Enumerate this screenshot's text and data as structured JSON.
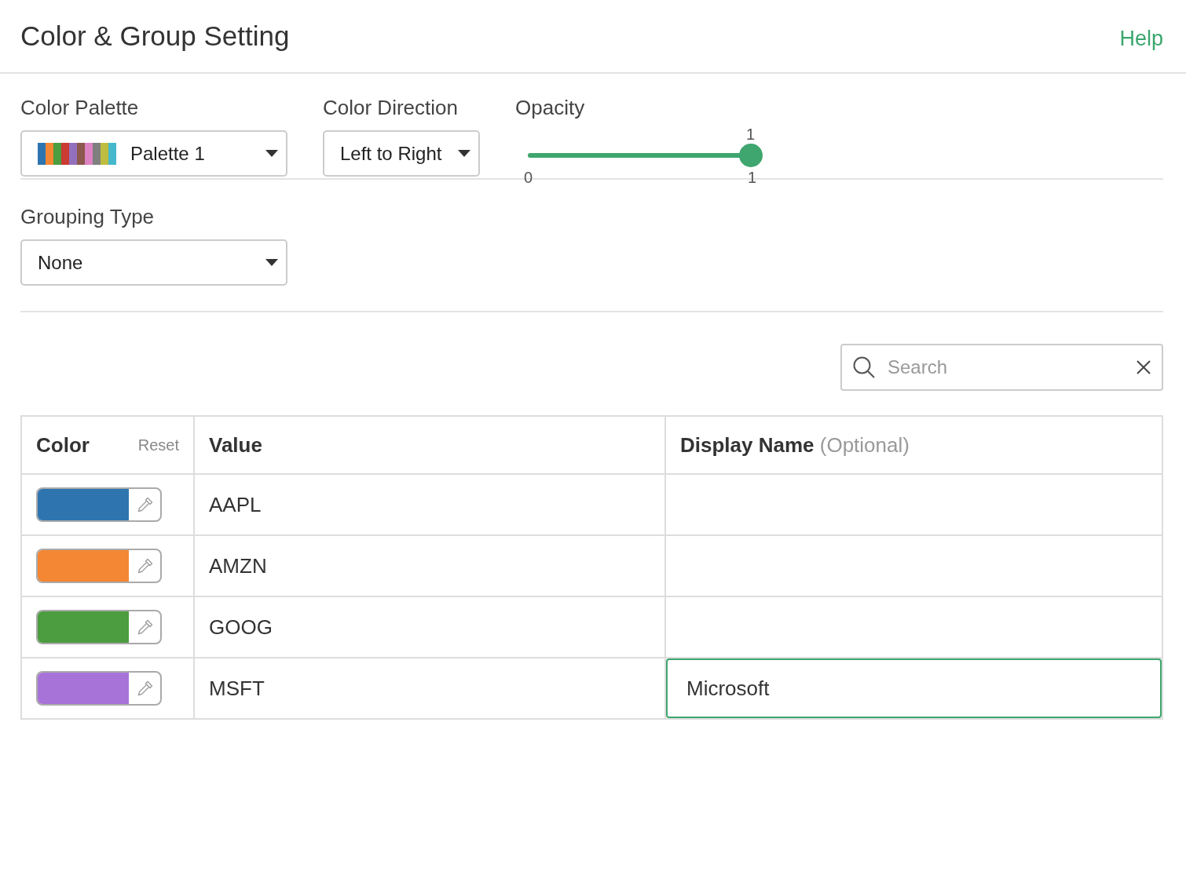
{
  "header": {
    "title": "Color & Group Setting",
    "help": "Help"
  },
  "color_palette": {
    "label": "Color Palette",
    "value": "Palette 1",
    "swatches": [
      {
        "color": "#2e75b0"
      },
      {
        "color": "#f48733"
      },
      {
        "color": "#4c9c40"
      },
      {
        "color": "#c93b33"
      },
      {
        "color": "#9370bd"
      },
      {
        "color": "#8c584d"
      },
      {
        "color": "#dd82c2"
      },
      {
        "color": "#7f7f7f"
      },
      {
        "color": "#bebd41"
      },
      {
        "color": "#45b9cb"
      }
    ]
  },
  "color_direction": {
    "label": "Color Direction",
    "value": "Left to Right"
  },
  "opacity": {
    "label": "Opacity",
    "level": 1,
    "value_label": "1",
    "min_label": "0",
    "max_label": "1"
  },
  "grouping_type": {
    "label": "Grouping Type",
    "value": "None"
  },
  "search": {
    "placeholder": "Search"
  },
  "table": {
    "columns": [
      {
        "label": "Color",
        "action": "Reset"
      },
      {
        "label": "Value"
      },
      {
        "label": "Display Name",
        "hint": "(Optional)"
      }
    ],
    "rows": [
      {
        "color": "#2e75b0",
        "value": "AAPL",
        "focused": false
      },
      {
        "color": "#f48733",
        "value": "AMZN",
        "focused": false
      },
      {
        "color": "#4c9c40",
        "value": "GOOG",
        "focused": false
      },
      {
        "color": "#a873d9",
        "value": "MSFT",
        "display_name": "Microsoft",
        "focused": true
      }
    ]
  }
}
